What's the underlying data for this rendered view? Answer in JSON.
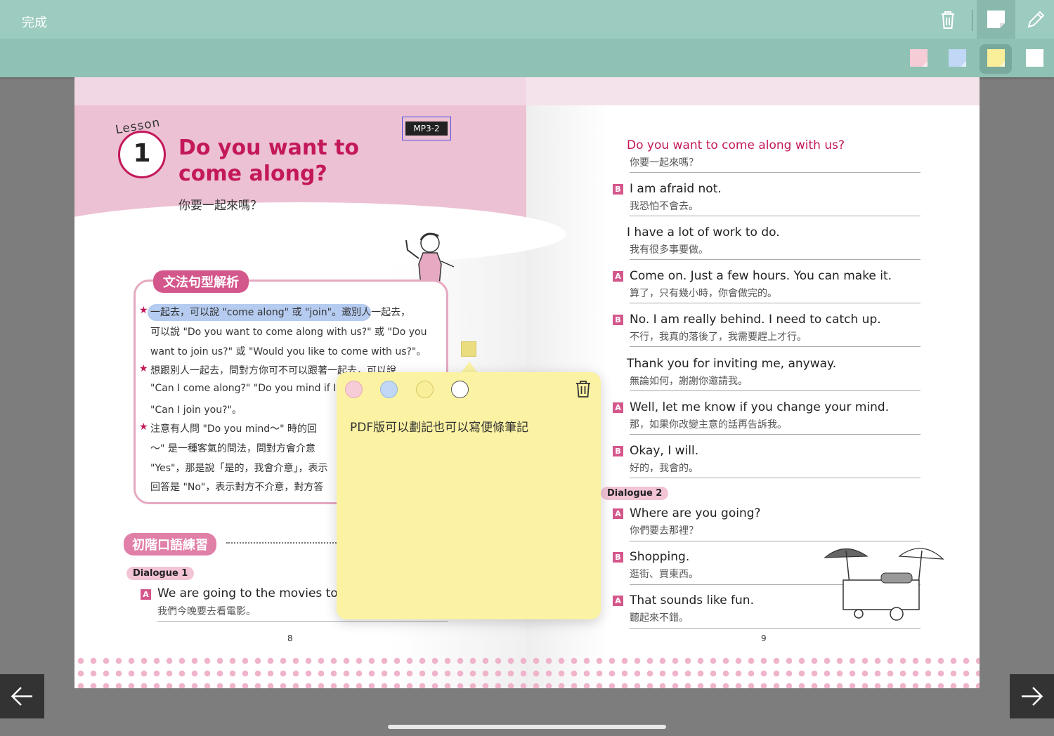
{
  "toolbar": {
    "done_label": "完成",
    "icons": [
      "trash-icon",
      "sticky-note-icon",
      "pencil-icon"
    ]
  },
  "note_colors": {
    "pink": "#f6cdd6",
    "blue": "#c0d7f5",
    "yellow": "#f9ee99",
    "white": "#ffffff",
    "selected": "yellow"
  },
  "lesson": {
    "lesson_word": "Lesson",
    "number": "1",
    "title": "Do you want to come along?",
    "subtitle": "你要一起來嗎？",
    "audio_tag": "MP3-2"
  },
  "grammar": {
    "label": "文法句型解析",
    "lines": [
      "一起去，可以說 \"come along\" 或 \"join\"。邀別人一起去，",
      "可以說 \"Do you want to come along with us?\" 或 \"Do you",
      "want to join us?\" 或 \"Would you like to come with us?\"。",
      "想跟別人一起去，問對方你可不可以跟著一起去，可以說",
      "\"Can I come along?\" \"Do you mind if I",
      "\"Can I join you?\"。",
      "注意有人問 \"Do you mind～\" 時的回",
      "～\" 是一種客氣的問法，問對方會介意",
      "\"Yes\"，那是說「是的，我會介意」，表示",
      "回答是 \"No\"，表示對方不介意，對方答"
    ]
  },
  "practice": {
    "label": "初階口語練習",
    "dialogue1_label": "Dialogue 1",
    "dialogue1_line_en": "We are going to the movies to",
    "dialogue1_line_zh": "我們今晚要去看電影。",
    "dialogue1_speaker": "A"
  },
  "right_page": {
    "lines": [
      {
        "speaker": "",
        "en": "Do you want to come along with us?",
        "zh": "你要一起來嗎？"
      },
      {
        "speaker": "B",
        "en": "I am afraid not.",
        "zh": "我恐怕不會去。"
      },
      {
        "speaker": "",
        "en": "I have a lot of work to do.",
        "zh": "我有很多事要做。"
      },
      {
        "speaker": "A",
        "en": "Come on. Just a few hours. You can make it.",
        "zh": "算了，只有幾小時，你會做完的。"
      },
      {
        "speaker": "B",
        "en": "No. I am really behind. I need to catch up.",
        "zh": "不行，我真的落後了，我需要趕上才行。"
      },
      {
        "speaker": "",
        "en": "Thank you for inviting me, anyway.",
        "zh": "無論如何，謝謝你邀請我。"
      },
      {
        "speaker": "A",
        "en": "Well, let me know if you change your mind.",
        "zh": "那，如果你改變主意的話再告訴我。"
      },
      {
        "speaker": "B",
        "en": "Okay, I will.",
        "zh": "好的，我會的。"
      }
    ],
    "dialogue2_label": "Dialogue 2",
    "dialogue2": [
      {
        "speaker": "A",
        "en": "Where are you going?",
        "zh": "你們要去那裡？"
      },
      {
        "speaker": "B",
        "en": "Shopping.",
        "zh": "逛街、買東西。"
      },
      {
        "speaker": "A",
        "en": "That sounds like fun.",
        "zh": "聽起來不錯。"
      }
    ]
  },
  "page_numbers": {
    "left": "8",
    "right": "9"
  },
  "sticky_note": {
    "text": "PDF版可以劃記也可以寫便條筆記"
  }
}
